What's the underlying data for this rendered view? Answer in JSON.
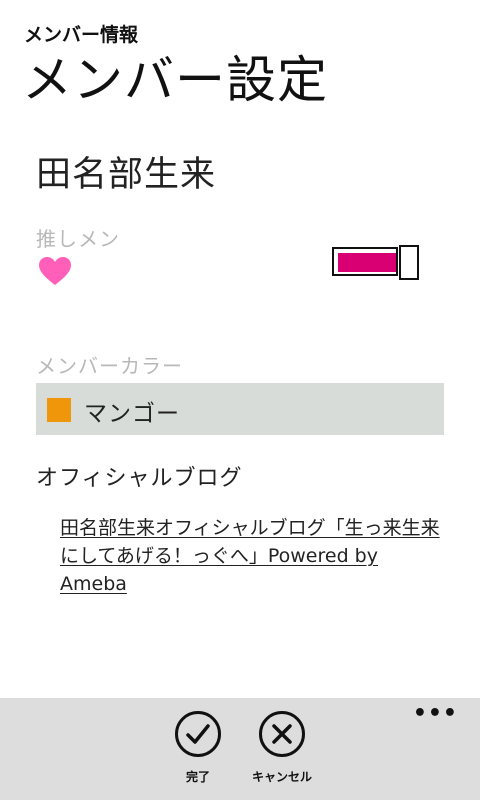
{
  "header": {
    "app_title": "メンバー情報",
    "page_title": "メンバー設定"
  },
  "member": {
    "name": "田名部生来"
  },
  "oshimen": {
    "label": "推しメン",
    "icon": "heart-icon",
    "heart_color": "#ff5fb8",
    "toggle_on": true,
    "toggle_color": "#d80073"
  },
  "member_color": {
    "label": "メンバーカラー",
    "selected_name": "マンゴー",
    "selected_swatch": "#f0960a"
  },
  "blog": {
    "heading": "オフィシャルブログ",
    "link_text": "田名部生来オフィシャルブログ「生っ来生来にしてあげる！っぐへ」Powered by Ameba"
  },
  "app_bar": {
    "more": "•••",
    "done_label": "完了",
    "done_icon": "check-circle-icon",
    "cancel_label": "キャンセル",
    "cancel_icon": "close-circle-icon"
  }
}
